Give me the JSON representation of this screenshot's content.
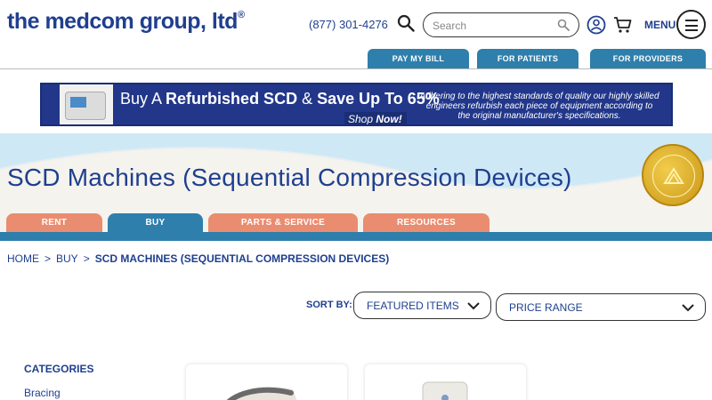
{
  "header": {
    "logo_text": "the medcom group, ltd",
    "logo_mark": "®",
    "phone": "(877) 301-4276",
    "search_placeholder": "Search",
    "menu_label": "MENU",
    "icons": [
      "search-icon",
      "user-icon",
      "cart-icon",
      "hamburger-icon"
    ]
  },
  "utility_tabs": [
    {
      "label": "PAY MY BILL"
    },
    {
      "label": "FOR PATIENTS"
    },
    {
      "label": "FOR PROVIDERS"
    }
  ],
  "banner": {
    "headline_prefix": "Buy A ",
    "headline_bold": "Refurbished SCD",
    "headline_suffix": " & ",
    "headline_bold2": "Save Up To 65%",
    "cta_prefix": "Shop ",
    "cta_bold": "Now!",
    "description": "Adhering to the highest standards of quality our highly skilled engineers refurbish each piece of equipment according to the original manufacturer's specifications."
  },
  "hero": {
    "title": "SCD Machines (Sequential Compression Devices)"
  },
  "nav_tabs": [
    {
      "label": "RENT",
      "active": false
    },
    {
      "label": "BUY",
      "active": true
    },
    {
      "label": "PARTS & SERVICE",
      "active": false
    },
    {
      "label": "RESOURCES",
      "active": false
    }
  ],
  "breadcrumb": {
    "items": [
      "HOME",
      "BUY"
    ],
    "separator": ">",
    "current": "SCD MACHINES (SEQUENTIAL COMPRESSION DEVICES)"
  },
  "sort": {
    "label": "SORT BY:",
    "sort_value": "FEATURED ITEMS",
    "price_value": "PRICE RANGE"
  },
  "sidebar": {
    "title": "CATEGORIES",
    "items": [
      "Bracing"
    ]
  },
  "colors": {
    "brand_blue": "#1f3f8f",
    "tab_blue": "#2e7fac",
    "tab_orange": "#ea8c6f",
    "hero_bg": "#cfe8f5"
  }
}
